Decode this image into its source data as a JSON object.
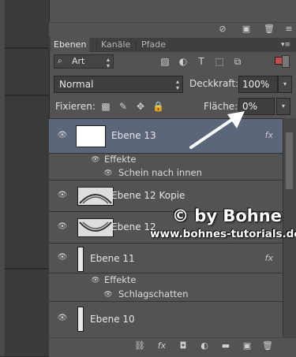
{
  "tabs": [
    {
      "label": "Ebenen",
      "active": true
    },
    {
      "label": "Kanäle",
      "active": false
    },
    {
      "label": "Pfade",
      "active": false
    }
  ],
  "filter": {
    "label": "Art",
    "icon": "search-icon"
  },
  "blend_mode": "Normal",
  "opacity_label": "Deckkraft:",
  "opacity_value": "100%",
  "lock_label": "Fixieren:",
  "fill_label": "Fläche:",
  "fill_value": "0%",
  "layers": [
    {
      "name": "Ebene 13",
      "fx": "fx",
      "selected": true,
      "effects_label": "Effekte",
      "effects": [
        "Schein nach innen"
      ]
    },
    {
      "name": "Ebene 12 Kopie"
    },
    {
      "name": "Ebene 12"
    },
    {
      "name": "Ebene 11",
      "fx": "fx",
      "effects_label": "Effekte",
      "effects": [
        "Schlagschatten"
      ]
    },
    {
      "name": "Ebene 10"
    }
  ],
  "watermark": {
    "line1": "© by Bohne",
    "line2": "www.bohnes-tutorials.de"
  },
  "colors": {
    "panel": "#535353",
    "selected": "#5b667a",
    "dark": "#2b2b2b"
  }
}
